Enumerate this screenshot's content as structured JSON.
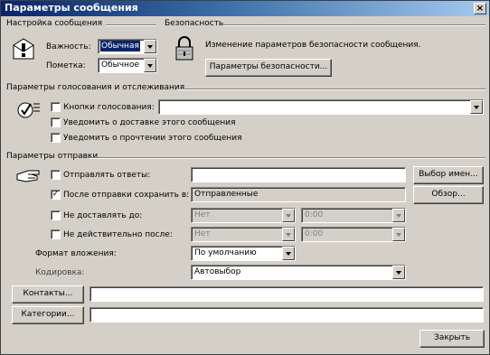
{
  "window": {
    "title": "Параметры сообщения",
    "close_label": "×"
  },
  "message_settings": {
    "legend": "Настройка сообщения",
    "importance_label": "Важность:",
    "importance_value": "Обычная",
    "sensitivity_label": "Пометка:",
    "sensitivity_value": "Обычное"
  },
  "security": {
    "legend": "Безопасность",
    "description": "Изменение параметров безопасности сообщения.",
    "button": "Параметры безопасности..."
  },
  "voting": {
    "legend": "Параметры голосования и отслеживания",
    "voting_buttons_label": "Кнопки голосования:",
    "voting_buttons_value": "",
    "delivery_receipt_label": "Уведомить о доставке этого сообщения",
    "read_receipt_label": "Уведомить о прочтении этого сообщения"
  },
  "delivery": {
    "legend": "Параметры отправки",
    "replies_to_label": "Отправлять ответы:",
    "replies_to_value": "",
    "select_names_button": "Выбор имен...",
    "save_sent_label": "После отправки сохранить в:",
    "save_sent_value": "Отправленные",
    "browse_button": "Обзор...",
    "do_not_deliver_label": "Не доставлять до:",
    "do_not_deliver_date": "Нет",
    "do_not_deliver_time": "0:00",
    "expires_label": "Не действительно после:",
    "expires_date": "Нет",
    "expires_time": "0:00",
    "attachment_format_label": "Формат вложения:",
    "attachment_format_value": "По умолчанию",
    "encoding_label": "Кодировка:",
    "encoding_value": "Автовыбор"
  },
  "contacts": {
    "button": "Контакты...",
    "value": ""
  },
  "categories": {
    "button": "Категории...",
    "value": ""
  },
  "footer": {
    "close_button": "Закрыть"
  },
  "checkboxes": {
    "voting_buttons": false,
    "delivery_receipt": false,
    "read_receipt": false,
    "replies_to": false,
    "save_sent": true,
    "do_not_deliver": false,
    "expires": false
  }
}
